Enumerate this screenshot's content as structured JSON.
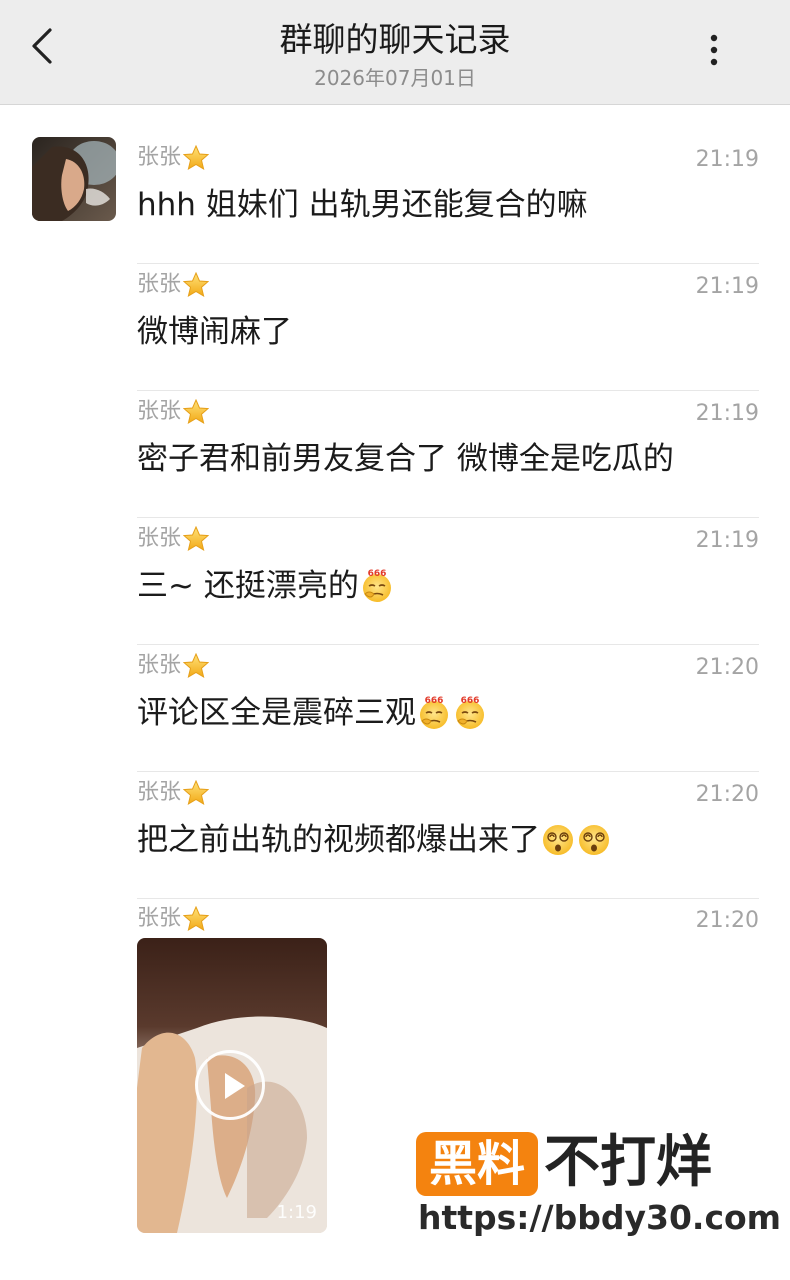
{
  "header": {
    "title": "群聊的聊天记录",
    "date": "2026年07月01日",
    "back_icon": "chevron-left-icon",
    "more_icon": "more-vertical-icon"
  },
  "messages": [
    {
      "sender": "张张",
      "time": "21:19",
      "text": "hhh 姐妹们 出轨男还能复合的嘛",
      "emojis": []
    },
    {
      "sender": "张张",
      "time": "21:19",
      "text": "微博闹麻了",
      "emojis": []
    },
    {
      "sender": "张张",
      "time": "21:19",
      "text": "密子君和前男友复合了 微博全是吃瓜的",
      "emojis": []
    },
    {
      "sender": "张张",
      "time": "21:19",
      "text": "三~ 还挺漂亮的",
      "emojis": [
        "666"
      ]
    },
    {
      "sender": "张张",
      "time": "21:20",
      "text": "评论区全是震碎三观",
      "emojis": [
        "666",
        "666"
      ]
    },
    {
      "sender": "张张",
      "time": "21:20",
      "text": "把之前出轨的视频都爆出来了",
      "emojis": [
        "dizzy",
        "dizzy"
      ]
    },
    {
      "sender": "张张",
      "time": "21:20",
      "text": "",
      "emojis": []
    }
  ],
  "video": {
    "duration": "1:19",
    "play_icon": "play-icon"
  },
  "watermark": {
    "box_text": "黑料",
    "rest_text": "不打烊",
    "url": "https://bbdy30.com",
    "box_color": "#f4830f"
  },
  "colors": {
    "header_bg": "#ededed",
    "meta_text": "#a4a4a4",
    "body_text": "#1b1b1b"
  }
}
